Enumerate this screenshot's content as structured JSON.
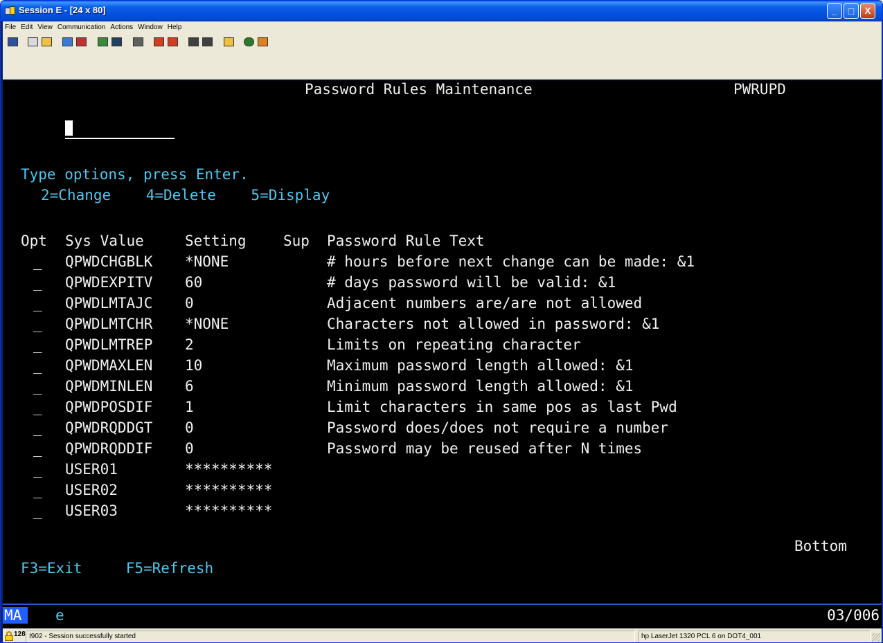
{
  "window": {
    "title": "Session E - [24 x 80]",
    "controls": {
      "minimize": "_",
      "maximize": "□",
      "close": "X"
    }
  },
  "menu": [
    "File",
    "Edit",
    "View",
    "Communication",
    "Actions",
    "Window",
    "Help"
  ],
  "toolbar": {
    "buttons": [
      {
        "icon": "print-screen-icon",
        "color": "#2f4f9f"
      },
      {
        "icon": "copy-icon",
        "color": "#d9d9d9"
      },
      {
        "icon": "paste-icon",
        "color": "#f0c040"
      },
      {
        "icon": "send-file-icon",
        "color": "#3c78d8"
      },
      {
        "icon": "receive-file-icon",
        "color": "#c03030"
      },
      {
        "icon": "display-icon",
        "color": "#3a8a3a"
      },
      {
        "icon": "display-2-icon",
        "color": "#204060"
      },
      {
        "icon": "keyboard-icon",
        "color": "#606060"
      },
      {
        "icon": "macro-record-icon",
        "color": "#d04020"
      },
      {
        "icon": "macro-play-icon",
        "color": "#d04020"
      },
      {
        "icon": "quick-macro-icon",
        "color": "#404040"
      },
      {
        "icon": "macro-stop-icon",
        "color": "#404040"
      },
      {
        "icon": "clipboard-icon",
        "color": "#f0c040"
      },
      {
        "icon": "globe-icon",
        "color": "#2a7a2a"
      },
      {
        "icon": "edit-icon",
        "color": "#e08020"
      }
    ]
  },
  "screen": {
    "title": "Password Rules Maintenance",
    "program": "PWRUPD",
    "instructions": "Type options, press Enter.",
    "options": "2=Change    4=Delete    5=Display",
    "columns": {
      "opt": "Opt",
      "sys_value": "Sys Value",
      "setting": "Setting",
      "sup": "Sup",
      "text": "Password Rule Text"
    },
    "rows": [
      {
        "opt": "_",
        "sys_value": "QPWDCHGBLK",
        "setting": "*NONE",
        "text": "# hours before next change can be made: &1"
      },
      {
        "opt": "_",
        "sys_value": "QPWDEXPITV",
        "setting": "60",
        "text": "# days password will be valid: &1"
      },
      {
        "opt": "_",
        "sys_value": "QPWDLMTAJC",
        "setting": "0",
        "text": "Adjacent numbers are/are not allowed"
      },
      {
        "opt": "_",
        "sys_value": "QPWDLMTCHR",
        "setting": "*NONE",
        "text": "Characters not allowed in password: &1"
      },
      {
        "opt": "_",
        "sys_value": "QPWDLMTREP",
        "setting": "2",
        "text": "Limits on repeating character"
      },
      {
        "opt": "_",
        "sys_value": "QPWDMAXLEN",
        "setting": "10",
        "text": "Maximum password length allowed: &1"
      },
      {
        "opt": "_",
        "sys_value": "QPWDMINLEN",
        "setting": "6",
        "text": "Minimum password length allowed: &1"
      },
      {
        "opt": "_",
        "sys_value": "QPWDPOSDIF",
        "setting": "1",
        "text": "Limit characters in same pos as last Pwd"
      },
      {
        "opt": "_",
        "sys_value": "QPWDRQDDGT",
        "setting": "0",
        "text": "Password does/does not require a number"
      },
      {
        "opt": "_",
        "sys_value": "QPWDRQDDIF",
        "setting": "0",
        "text": "Password may be reused after N times"
      },
      {
        "opt": "_",
        "sys_value": "USER01",
        "setting": "**********",
        "text": ""
      },
      {
        "opt": "_",
        "sys_value": "USER02",
        "setting": "**********",
        "text": ""
      },
      {
        "opt": "_",
        "sys_value": "USER03",
        "setting": "**********",
        "text": ""
      }
    ],
    "more": "Bottom",
    "fkeys": "F3=Exit     F5=Refresh"
  },
  "oia": {
    "indicator": "MA",
    "mode": "e",
    "cursor_pos": "03/006"
  },
  "statusbar": {
    "session_number": "128",
    "message": "I902 - Session successfully started",
    "printer": "hp LaserJet 1320 PCL 6 on DOT4_001"
  }
}
